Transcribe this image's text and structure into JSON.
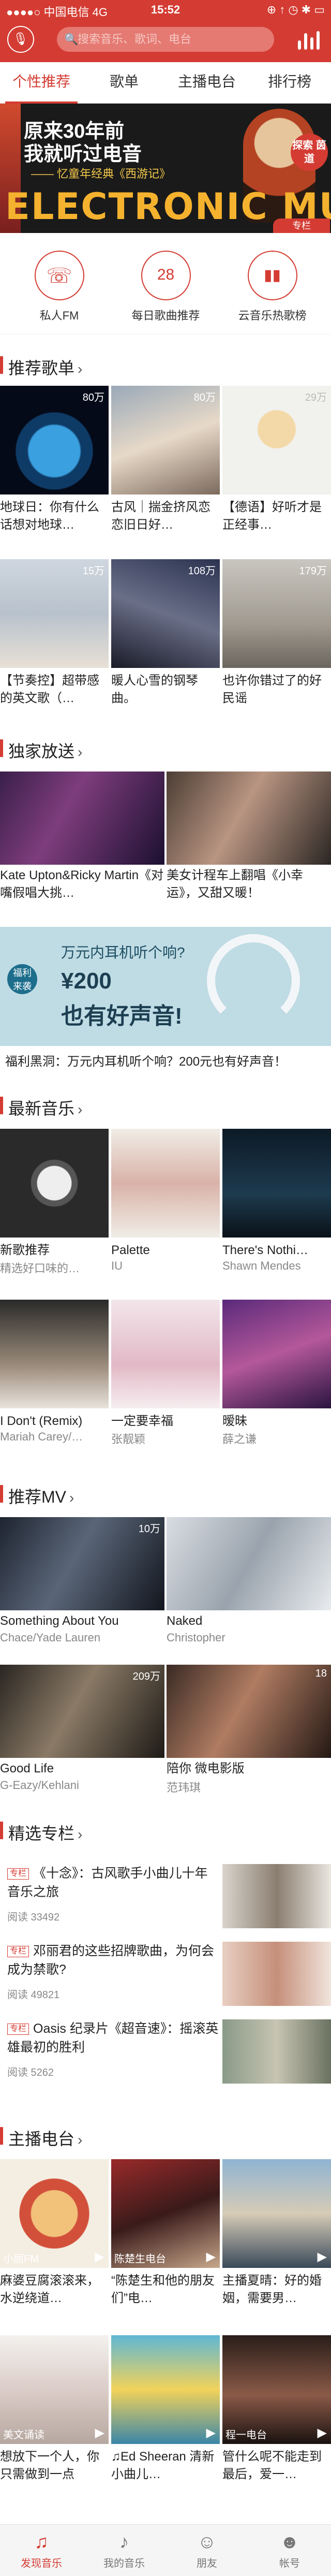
{
  "status": {
    "carrier": "●●●●○ 中国电信  4G",
    "time": "15:52",
    "right": "⊕ ↑ ◷ ✱ ▭"
  },
  "header": {
    "search_placeholder": "搜索音乐、歌词、电台",
    "mic_icon": "microphone-icon",
    "rank_icon": "equalizer-icon"
  },
  "tabs": [
    "个性推荐",
    "歌单",
    "主播电台",
    "排行榜"
  ],
  "banner": {
    "line1": "原来30年前",
    "line2": "我就听过电音",
    "line3": "—— 忆童年经典《西游记》",
    "big": "ELECTRONIC MUSIC",
    "badge": "专栏",
    "ribbon": "探索 茵道"
  },
  "quick": [
    {
      "label": "私人FM",
      "glyph": "☏",
      "icon": "radio-icon"
    },
    {
      "label": "每日歌曲推荐",
      "glyph": "28",
      "icon": "calendar-icon"
    },
    {
      "label": "云音乐热歌榜",
      "glyph": "▮▮",
      "icon": "chart-icon"
    }
  ],
  "sections": {
    "playlists": "推荐歌单",
    "exclusive": "独家放送",
    "newmusic": "最新音乐",
    "mv": "推荐MV",
    "columns": "精选专栏",
    "radio": "主播电台"
  },
  "playlists": [
    {
      "count": "80万",
      "title": "地球日：你有什么话想对地球…"
    },
    {
      "count": "80万",
      "title": "古风｜揣金挤风恋恋旧日好…"
    },
    {
      "count": "29万",
      "title": "【德语】好听才是正经事…"
    },
    {
      "count": "15万",
      "title": "【节奏控】超带感的英文歌（…"
    },
    {
      "count": "108万",
      "title": "暖人心雪的钢琴曲。"
    },
    {
      "count": "179万",
      "title": "也许你错过了的好民谣"
    }
  ],
  "exclusive": [
    {
      "title": "Kate Upton&Ricky Martin《对嘴假唱大挑…"
    },
    {
      "title": "美女计程车上翻唱《小幸运》，又甜又暖！"
    }
  ],
  "ad": {
    "tag": "福利 来袭",
    "line1": "万元内耳机听个响?",
    "line2": "¥200",
    "line3": "也有好声音!",
    "caption": "福利黑洞：万元内耳机听个响？200元也有好声音！"
  },
  "newmusic": [
    {
      "title": "新歌推荐",
      "sub": "精选好口味的…"
    },
    {
      "title": "Palette",
      "sub": "IU"
    },
    {
      "title": "There's Nothi…",
      "sub": "Shawn Mendes"
    },
    {
      "title": "I Don't (Remix)",
      "sub": "Mariah Carey/…"
    },
    {
      "title": "一定要幸福",
      "sub": "张靓颖"
    },
    {
      "title": "暧昧",
      "sub": "薛之谦"
    }
  ],
  "mv": [
    {
      "count": "10万",
      "title": "Something About You",
      "sub": "Chace/Yade Lauren"
    },
    {
      "count": "",
      "title": "Naked",
      "sub": "Christopher"
    },
    {
      "count": "209万",
      "title": "Good Life",
      "sub": "G-Eazy/Kehlani"
    },
    {
      "count": "18",
      "title": "陪你 微电影版",
      "sub": "范玮琪"
    }
  ],
  "columns": [
    {
      "badge": "专栏",
      "title": "《十念》：古风歌手小曲儿十年音乐之旅",
      "meta": "阅读 33492"
    },
    {
      "badge": "专栏",
      "title": "邓丽君的这些招牌歌曲，为何会成为禁歌?",
      "meta": "阅读 49821"
    },
    {
      "badge": "专栏",
      "title": "Oasis 纪录片《超音速》：摇滚英雄最初的胜利",
      "meta": "阅读 5262"
    }
  ],
  "radio": [
    {
      "overlay": "小丽FM",
      "title": "麻婆豆腐滚滚来，水逆绕道…"
    },
    {
      "overlay": "陈楚生电台",
      "title": "“陈楚生和他的朋友们”电…"
    },
    {
      "overlay": "",
      "title": "主播夏晴：好的婚姻，需要男…"
    },
    {
      "overlay": "美文诵读",
      "title": "想放下一个人，你只需做到一点"
    },
    {
      "overlay": "",
      "title": "♫Ed Sheeran 清新小曲儿…"
    },
    {
      "overlay": "程一电台",
      "title": "管什么呢不能走到最后，爱一…"
    }
  ],
  "nav": [
    {
      "label": "发现音乐",
      "glyph": "♫",
      "icon": "discover-music-icon"
    },
    {
      "label": "我的音乐",
      "glyph": "♪",
      "icon": "my-music-icon"
    },
    {
      "label": "朋友",
      "glyph": "☺",
      "icon": "friends-icon"
    },
    {
      "label": "帐号",
      "glyph": "☻",
      "icon": "account-icon"
    }
  ]
}
